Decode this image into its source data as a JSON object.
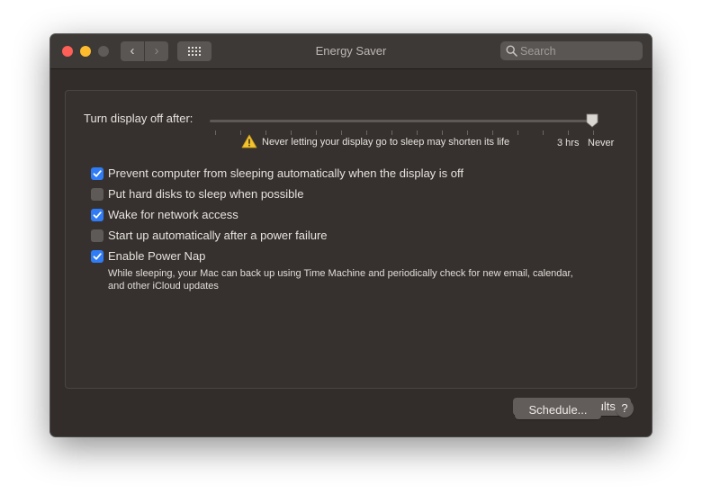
{
  "window": {
    "title": "Energy Saver"
  },
  "toolbar": {
    "back_glyph": "‹",
    "forward_glyph": "›",
    "show_all_icon": "grid-icon"
  },
  "search": {
    "placeholder": "Search",
    "value": ""
  },
  "display_sleep": {
    "label": "Turn display off after:",
    "warning_text": "Never letting your display go to sleep may shorten its life",
    "scale_label_3hrs": "3 hrs",
    "scale_label_never": "Never",
    "selected_value": "Never"
  },
  "options": [
    {
      "label": "Prevent computer from sleeping automatically when the display is off",
      "checked": true
    },
    {
      "label": "Put hard disks to sleep when possible",
      "checked": false
    },
    {
      "label": "Wake for network access",
      "checked": true
    },
    {
      "label": "Start up automatically after a power failure",
      "checked": false
    },
    {
      "label": "Enable Power Nap",
      "checked": true,
      "description": "While sleeping, your Mac can back up using Time Machine and periodically check for new email, calendar, and other iCloud updates"
    }
  ],
  "buttons": {
    "restore_defaults": "Restore Defaults",
    "schedule": "Schedule...",
    "help": "?"
  },
  "colors": {
    "accent": "#2f7cf6",
    "window_bg": "#322d2a",
    "close": "#fe5f57",
    "minimize": "#febb2e"
  }
}
